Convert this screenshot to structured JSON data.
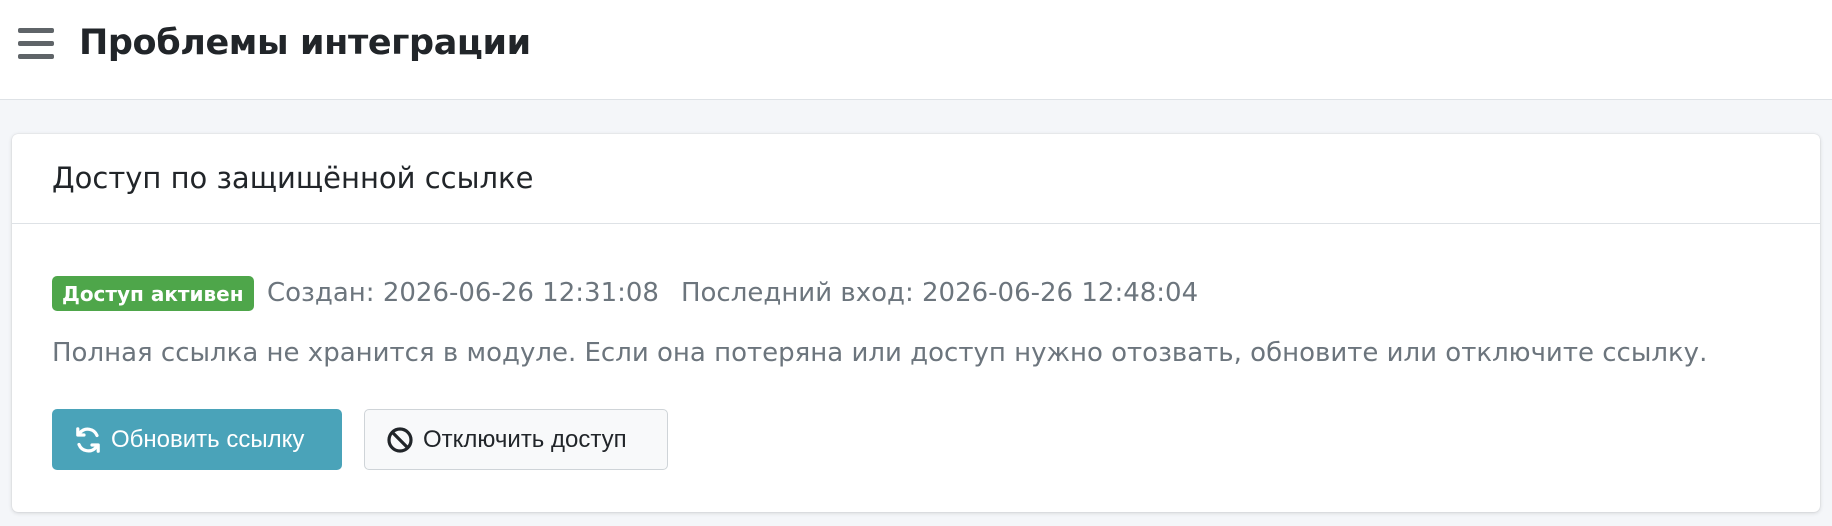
{
  "header": {
    "title": "Проблемы интеграции",
    "menu_icon": "hamburger-menu-icon"
  },
  "card": {
    "title": "Доступ по защищённой ссылке",
    "status_badge": "Доступ активен",
    "created": "Создан: 2026-06-26 12:31:08",
    "last_login": "Последний вход: 2026-06-26 12:48:04",
    "description": "Полная ссылка не хранится в модуле. Если она потеряна или доступ нужно отозвать, обновите или отключите ссылку.",
    "buttons": {
      "refresh": {
        "label": "Обновить ссылку",
        "icon": "refresh-icon"
      },
      "disable": {
        "label": "Отключить доступ",
        "icon": "ban-icon"
      }
    }
  },
  "colors": {
    "page_background": "#f4f6f9",
    "success": "#4ea64a",
    "info": "#4aa3b9",
    "muted_text": "#6c757d",
    "border": "#dee2e6"
  }
}
